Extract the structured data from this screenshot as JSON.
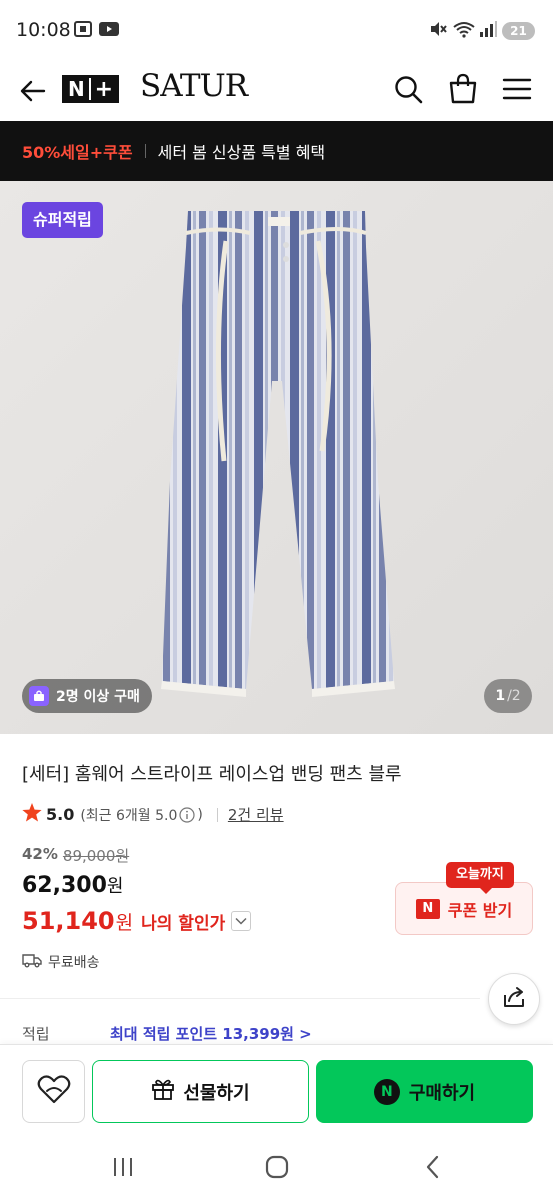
{
  "status_bar": {
    "time": "10:08",
    "battery": "21"
  },
  "header": {
    "nplus_label": "N+",
    "brand": "SATUR"
  },
  "promo": {
    "highlight": "50%세일+쿠폰",
    "text": "세터 봄 신상품 특별 혜택"
  },
  "image": {
    "badge": "슈퍼적립",
    "group_pill": "2명 이상 구매",
    "page_current": "1",
    "page_total": "/2"
  },
  "product": {
    "title": "[세터] 홈웨어 스트라이프 레이스업 밴딩 팬츠 블루",
    "rating": "5.0",
    "recent_rating": "(최근 6개월 5.0",
    "recent_close": ")",
    "reviews": "2건 리뷰",
    "discount_pct": "42%",
    "original_price": "89,000원",
    "price": "62,300",
    "price_unit": "원",
    "my_price": "51,140",
    "my_price_unit": "원",
    "my_price_label": "나의 할인가",
    "shipping": "무료배송",
    "points_label": "적립",
    "points_value": "최대 적립 포인트 13,399원 >"
  },
  "coupon": {
    "tag": "오늘까지",
    "button": "쿠폰 받기",
    "n": "N"
  },
  "actions": {
    "gift": "선물하기",
    "buy": "구매하기",
    "buy_n": "N"
  },
  "colors": {
    "naver_green": "#03c75a",
    "sale_red": "#e0251d",
    "super_purple": "#6b45e0",
    "points_blue": "#3e43c9"
  }
}
